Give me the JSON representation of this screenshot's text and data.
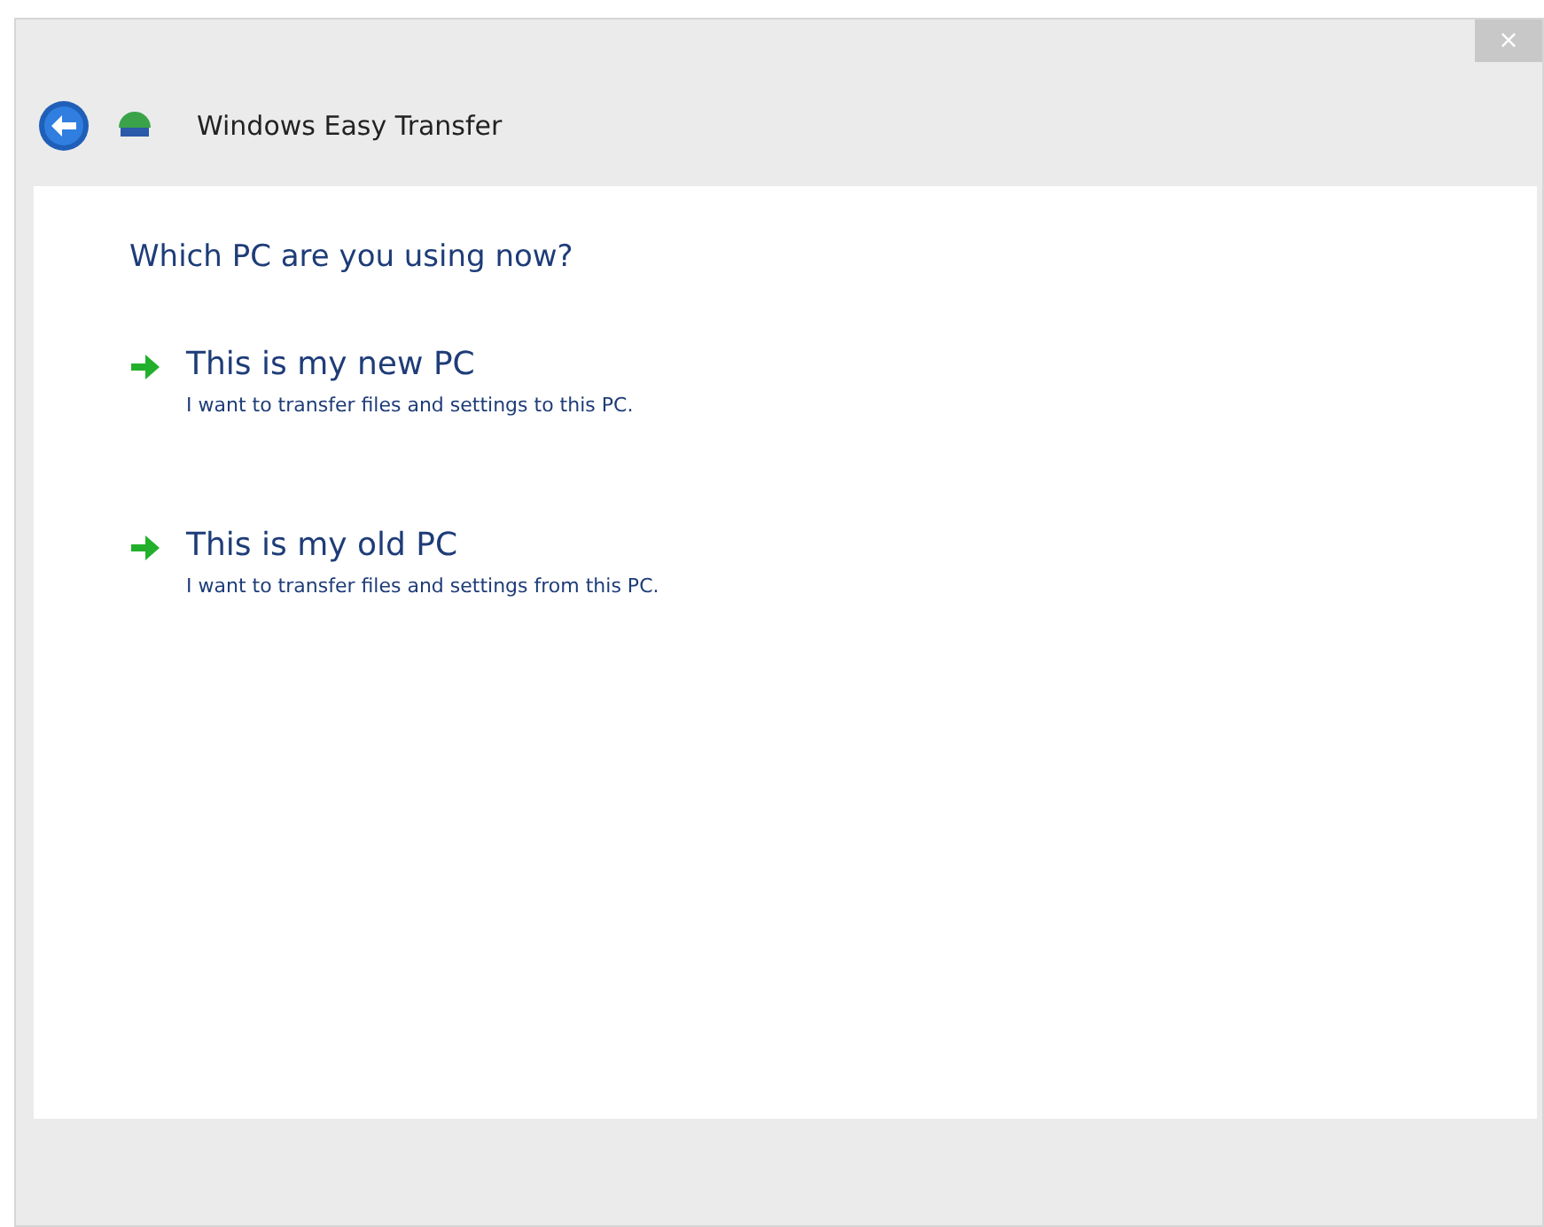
{
  "window": {
    "title": "Windows Easy Transfer",
    "close_symbol": "×"
  },
  "heading": "Which PC are you using now?",
  "options": [
    {
      "title": "This is my new PC",
      "description": "I want to transfer files and settings to this PC."
    },
    {
      "title": "This is my old PC",
      "description": "I want to transfer files and settings from this PC."
    }
  ]
}
